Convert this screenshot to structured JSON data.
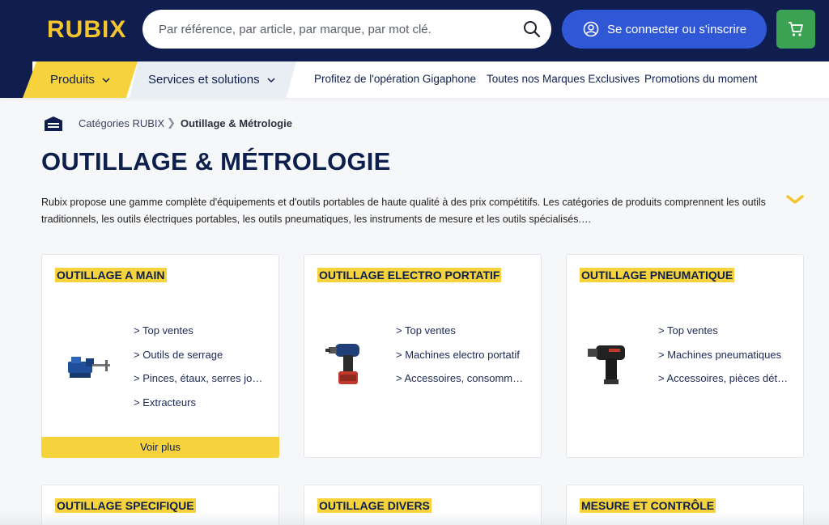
{
  "header": {
    "logo": "RUBIX",
    "search_placeholder": "Par référence, par article, par marque, par mot clé.",
    "login_label": "Se connecter ou s'inscrire"
  },
  "nav": {
    "produits": "Produits",
    "services": "Services et solutions",
    "links": [
      "Profitez de l'opération Gigaphone",
      "Toutes nos Marques Exclusives",
      "Promotions du moment"
    ]
  },
  "breadcrumb": {
    "parent": "Catégories RUBIX",
    "separator": "❯",
    "current": "Outillage & Métrologie"
  },
  "page": {
    "title": "OUTILLAGE & MÉTROLOGIE",
    "description": "Rubix propose une gamme complète d'équipements et d'outils portables de haute qualité à des prix compétitifs. Les catégories de produits comprennent les outils traditionnels, les outils électriques portables, les outils pneumatiques, les instruments de mesure et les outils spécialisés.…"
  },
  "cards": [
    {
      "title": "OUTILLAGE A MAIN",
      "icon": "vise-icon",
      "links": [
        "> Top ventes",
        "> Outils de serrage",
        "> Pinces, étaux, serres joints",
        "> Extracteurs"
      ],
      "voir_plus": "Voir plus"
    },
    {
      "title": "OUTILLAGE ELECTRO PORTATIF",
      "icon": "drill-icon",
      "links": [
        "> Top ventes",
        "> Machines electro portatif",
        "> Accessoires, consommables"
      ]
    },
    {
      "title": "OUTILLAGE PNEUMATIQUE",
      "icon": "impact-wrench-icon",
      "links": [
        "> Top ventes",
        "> Machines pneumatiques",
        "> Accessoires, pièces détachées"
      ]
    },
    {
      "title": "OUTILLAGE SPECIFIQUE"
    },
    {
      "title": "OUTILLAGE DIVERS"
    },
    {
      "title": "MESURE ET CONTRÔLE"
    }
  ],
  "colors": {
    "navy": "#101e4f",
    "yellow": "#f6d33c",
    "blue": "#2f57d6",
    "green": "#3ba254"
  }
}
